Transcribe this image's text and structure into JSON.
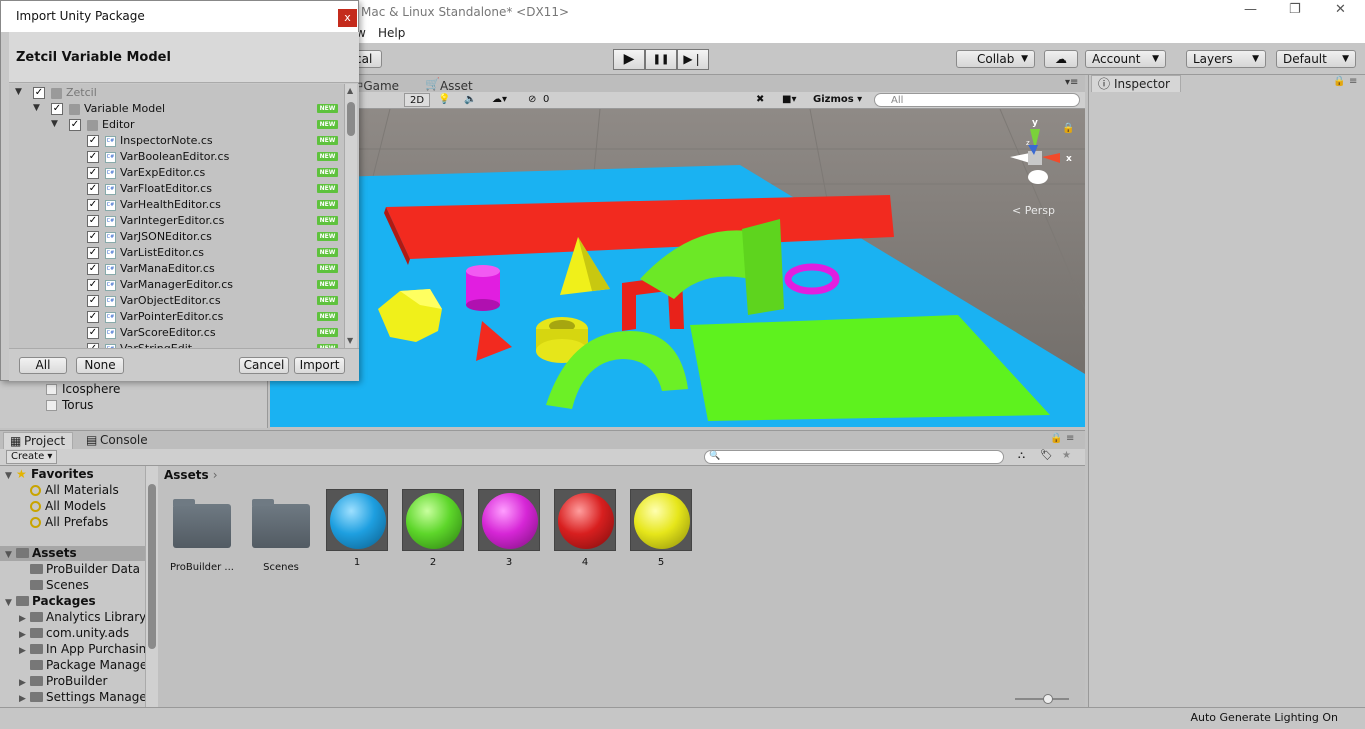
{
  "window": {
    "title": "Mac & Linux Standalone* <DX11>",
    "minimize_glyph": "—",
    "restore_glyph": "❐",
    "close_glyph": "✕"
  },
  "menu": {
    "items": [
      "w",
      "Help"
    ]
  },
  "toolbar": {
    "local_label": "cal",
    "play_glyph": "▶",
    "pause_glyph": "❚❚",
    "step_glyph": "▶❘",
    "collab_label": "Collab",
    "account_label": "Account",
    "layers_label": "Layers",
    "layout_label": "Default",
    "cloud_icon": "cloud-icon"
  },
  "scene": {
    "tabs": [
      "Game",
      "Asset Store"
    ],
    "toolbar": {
      "mode_2d": "2D",
      "hidden_count": "0",
      "gizmos_label": "Gizmos",
      "search_placeholder": "All"
    },
    "gizmo_labels": {
      "y": "y",
      "x": "x",
      "z": "z"
    },
    "persp_label": "Persp"
  },
  "hierarchy": {
    "items": [
      "Icosphere",
      "Torus"
    ]
  },
  "inspector": {
    "tab_label": "Inspector"
  },
  "project": {
    "tabs": [
      "Project",
      "Console"
    ],
    "create_label": "Create",
    "tree": {
      "favorites_label": "Favorites",
      "favorites": [
        "All Materials",
        "All Models",
        "All Prefabs"
      ],
      "assets_label": "Assets",
      "assets": [
        "ProBuilder Data",
        "Scenes"
      ],
      "packages_label": "Packages",
      "packages": [
        "Analytics Library",
        "com.unity.ads",
        "In App Purchasin",
        "Package Manage",
        "ProBuilder",
        "Settings Manage"
      ]
    },
    "breadcrumb": "Assets",
    "assets": [
      {
        "label": "ProBuilder ...",
        "kind": "folder"
      },
      {
        "label": "Scenes",
        "kind": "folder"
      },
      {
        "label": "1",
        "kind": "material",
        "color": "#1e9fe0"
      },
      {
        "label": "2",
        "kind": "material",
        "color": "#5dd62a"
      },
      {
        "label": "3",
        "kind": "material",
        "color": "#d626d6"
      },
      {
        "label": "4",
        "kind": "material",
        "color": "#d81f1f"
      },
      {
        "label": "5",
        "kind": "material",
        "color": "#e6e61a"
      }
    ]
  },
  "status": {
    "text": "Auto Generate Lighting On"
  },
  "dialog": {
    "title": "Import Unity Package",
    "close_glyph": "x",
    "package_name": "Zetcil Variable Model",
    "new_badge": "NEW",
    "cs_badge": "C#",
    "check_glyph": "✓",
    "tree": [
      {
        "label": "Zetcil",
        "depth": 0,
        "type": "folder",
        "dim": true
      },
      {
        "label": "Variable Model",
        "depth": 1,
        "type": "folder",
        "dim": false
      },
      {
        "label": "Editor",
        "depth": 2,
        "type": "folder",
        "dim": false
      },
      {
        "label": "InspectorNote.cs",
        "depth": 3,
        "type": "script",
        "dim": false
      },
      {
        "label": "VarBooleanEditor.cs",
        "depth": 3,
        "type": "script",
        "dim": false
      },
      {
        "label": "VarExpEditor.cs",
        "depth": 3,
        "type": "script",
        "dim": false
      },
      {
        "label": "VarFloatEditor.cs",
        "depth": 3,
        "type": "script",
        "dim": false
      },
      {
        "label": "VarHealthEditor.cs",
        "depth": 3,
        "type": "script",
        "dim": false
      },
      {
        "label": "VarIntegerEditor.cs",
        "depth": 3,
        "type": "script",
        "dim": false
      },
      {
        "label": "VarJSONEditor.cs",
        "depth": 3,
        "type": "script",
        "dim": false
      },
      {
        "label": "VarListEditor.cs",
        "depth": 3,
        "type": "script",
        "dim": false
      },
      {
        "label": "VarManaEditor.cs",
        "depth": 3,
        "type": "script",
        "dim": false
      },
      {
        "label": "VarManagerEditor.cs",
        "depth": 3,
        "type": "script",
        "dim": false
      },
      {
        "label": "VarObjectEditor.cs",
        "depth": 3,
        "type": "script",
        "dim": false
      },
      {
        "label": "VarPointerEditor.cs",
        "depth": 3,
        "type": "script",
        "dim": false
      },
      {
        "label": "VarScoreEditor.cs",
        "depth": 3,
        "type": "script",
        "dim": false
      },
      {
        "label": "VarStringEdit...",
        "depth": 3,
        "type": "script",
        "dim": false
      }
    ],
    "buttons": {
      "all": "All",
      "none": "None",
      "cancel": "Cancel",
      "import": "Import"
    }
  }
}
